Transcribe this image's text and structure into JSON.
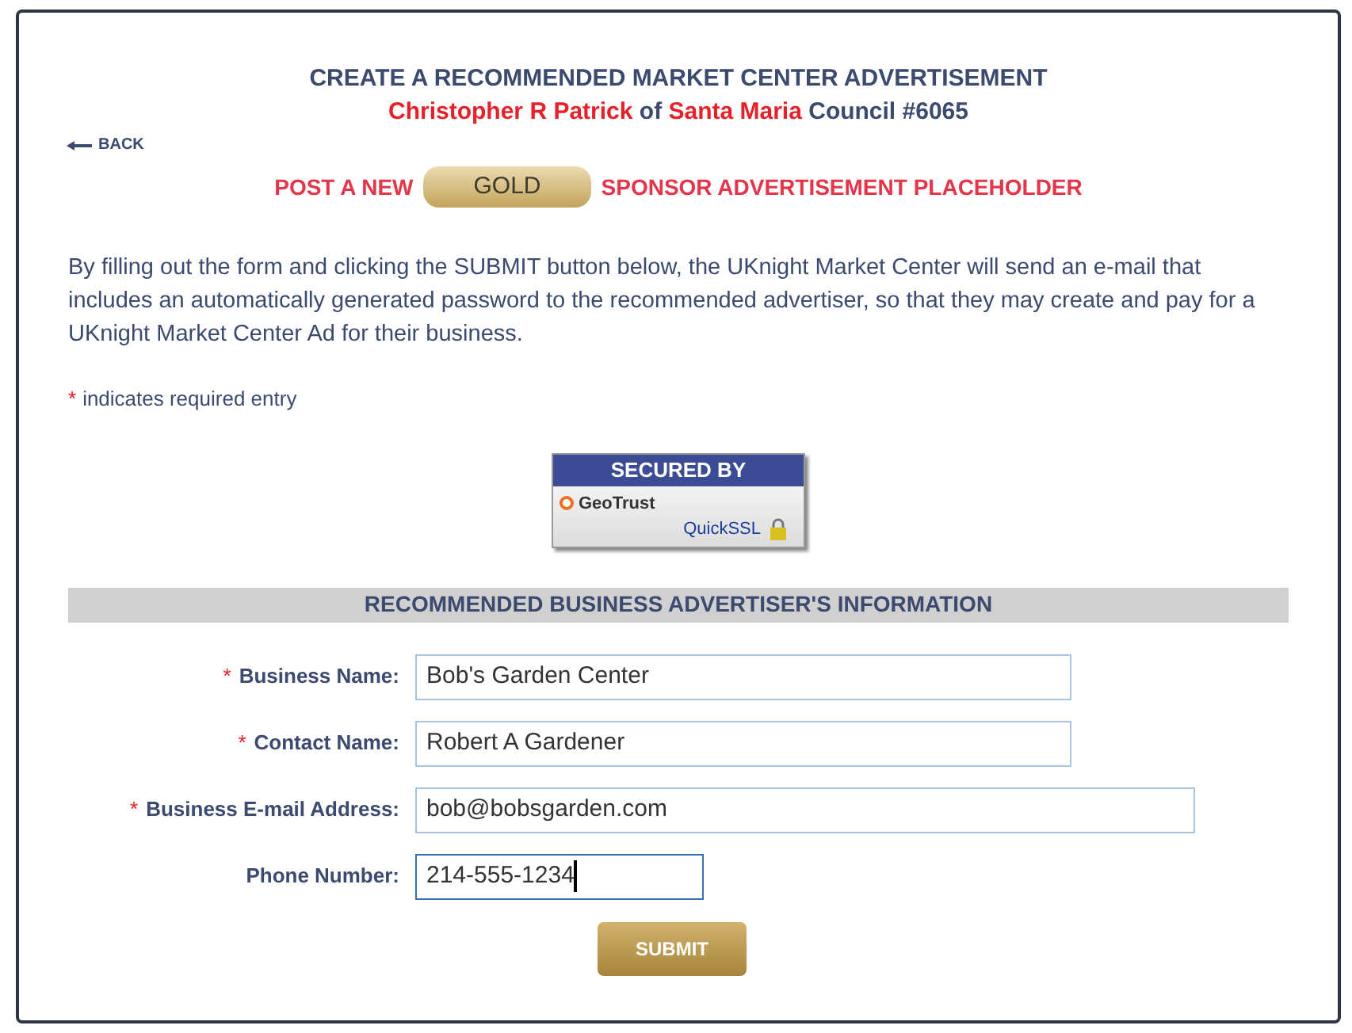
{
  "header": {
    "title": "CREATE A RECOMMENDED MARKET CENTER ADVERTISEMENT",
    "subtitle_parts": [
      {
        "text": "Christopher R Patrick",
        "emphasis": true
      },
      {
        "text": " of ",
        "emphasis": false
      },
      {
        "text": "Santa Maria",
        "emphasis": true
      },
      {
        "text": " Council #6065",
        "emphasis": false
      }
    ]
  },
  "back_link": "BACK",
  "post_line": {
    "before": "POST A NEW",
    "level_badge": "GOLD",
    "after": "SPONSOR ADVERTISEMENT PLACEHOLDER"
  },
  "intro": "By filling out the form and clicking the SUBMIT button below, the UKnight Market Center will send an e-mail that includes an automatically generated password to the recommended advertiser, so that they may create and pay for a UKnight Market Center Ad for their business.",
  "required_note": {
    "mark": "*",
    "text": "indicates required entry"
  },
  "seal": {
    "heading": "SECURED BY",
    "brand": "GeoTrust",
    "product": "QuickSSL"
  },
  "section_title": "RECOMMENDED BUSINESS ADVERTISER'S INFORMATION",
  "fields": [
    {
      "label": "Business Name:",
      "required": true,
      "value": "Bob's Garden Center",
      "kind": "name",
      "focused": false
    },
    {
      "label": "Contact Name:",
      "required": true,
      "value": "Robert A Gardener",
      "kind": "name",
      "focused": false
    },
    {
      "label": "Business E-mail Address:",
      "required": true,
      "value": "bob@bobsgarden.com",
      "kind": "email",
      "focused": false
    },
    {
      "label": "Phone Number:",
      "required": false,
      "value": "214-555-1234",
      "kind": "phone",
      "focused": true
    }
  ],
  "submit": "SUBMIT"
}
